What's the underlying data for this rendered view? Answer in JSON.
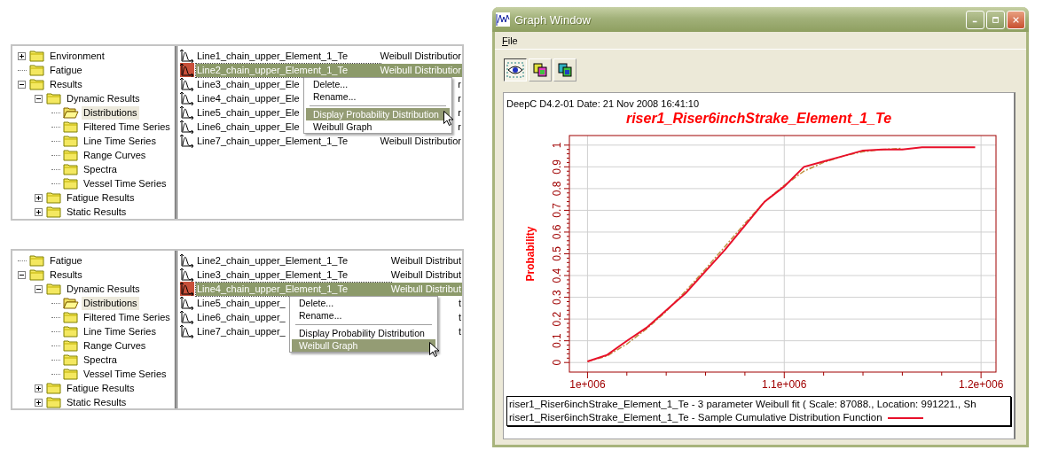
{
  "tree_panels": [
    {
      "tree": [
        {
          "label": "Environment",
          "expanded": false,
          "selected": false
        },
        {
          "label": "Fatigue",
          "selected": false
        },
        {
          "label": "Results",
          "expanded": true,
          "selected": false,
          "children": [
            {
              "label": "Dynamic Results",
              "expanded": true,
              "selected": false,
              "children": [
                {
                  "label": "Distributions",
                  "selected": true
                },
                {
                  "label": "Filtered Time Series",
                  "selected": false
                },
                {
                  "label": "Line Time Series",
                  "selected": false
                },
                {
                  "label": "Range Curves",
                  "selected": false
                },
                {
                  "label": "Spectra",
                  "selected": false
                },
                {
                  "label": "Vessel Time Series",
                  "selected": false
                }
              ]
            },
            {
              "label": "Fatigue Results",
              "expanded": false,
              "selected": false
            },
            {
              "label": "Static Results",
              "expanded": false,
              "selected": false
            }
          ]
        }
      ],
      "list": [
        {
          "name": "Line1_chain_upper_Element_1_Te",
          "type": "Weibull Distributior",
          "selected": false
        },
        {
          "name": "Line2_chain_upper_Element_1_Te",
          "type": "Weibull Distributior",
          "selected": true
        },
        {
          "name": "Line3_chain_upper_Ele",
          "type": "r",
          "selected": false
        },
        {
          "name": "Line4_chain_upper_Ele",
          "type": "r",
          "selected": false
        },
        {
          "name": "Line5_chain_upper_Ele",
          "type": "r",
          "selected": false
        },
        {
          "name": "Line6_chain_upper_Ele",
          "type": "r",
          "selected": false
        },
        {
          "name": "Line7_chain_upper_Element_1_Te",
          "type": "Weibull Distributior",
          "selected": false
        }
      ],
      "context_menu": [
        {
          "kind": "item",
          "label": "Delete...",
          "highlighted": false
        },
        {
          "kind": "item",
          "label": "Rename...",
          "highlighted": false
        },
        {
          "kind": "separator"
        },
        {
          "kind": "item",
          "label": "Display Probability Distribution",
          "highlighted": true
        },
        {
          "kind": "item",
          "label": "Weibull Graph",
          "highlighted": false
        }
      ]
    },
    {
      "tree": [
        {
          "label": "Fatigue",
          "selected": false
        },
        {
          "label": "Results",
          "expanded": true,
          "selected": false,
          "children": [
            {
              "label": "Dynamic Results",
              "expanded": true,
              "selected": false,
              "children": [
                {
                  "label": "Distributions",
                  "selected": true
                },
                {
                  "label": "Filtered Time Series",
                  "selected": false
                },
                {
                  "label": "Line Time Series",
                  "selected": false
                },
                {
                  "label": "Range Curves",
                  "selected": false
                },
                {
                  "label": "Spectra",
                  "selected": false
                },
                {
                  "label": "Vessel Time Series",
                  "selected": false
                }
              ]
            },
            {
              "label": "Fatigue Results",
              "expanded": false,
              "selected": false
            },
            {
              "label": "Static Results",
              "expanded": false,
              "selected": false
            }
          ]
        }
      ],
      "list": [
        {
          "name": "Line2_chain_upper_Element_1_Te",
          "type": "Weibull Distribut",
          "selected": false
        },
        {
          "name": "Line3_chain_upper_Element_1_Te",
          "type": "Weibull Distribut",
          "selected": false
        },
        {
          "name": "Line4_chain_upper_Element_1_Te",
          "type": "Weibull Distribut",
          "selected": true
        },
        {
          "name": "Line5_chain_upper_",
          "type": "t",
          "selected": false
        },
        {
          "name": "Line6_chain_upper_",
          "type": "t",
          "selected": false
        },
        {
          "name": "Line7_chain_upper_",
          "type": "t",
          "selected": false
        }
      ],
      "context_menu": [
        {
          "kind": "item",
          "label": "Delete...",
          "highlighted": false
        },
        {
          "kind": "item",
          "label": "Rename...",
          "highlighted": false
        },
        {
          "kind": "separator"
        },
        {
          "kind": "item",
          "label": "Display Probability Distribution",
          "highlighted": false
        },
        {
          "kind": "item",
          "label": "Weibull Graph",
          "highlighted": true
        }
      ]
    }
  ],
  "graph_window": {
    "title": "Graph Window",
    "menu": [
      "File"
    ],
    "toolbar": [
      {
        "kind": "view",
        "pressed": true
      },
      {
        "kind": "copy",
        "pressed": false
      },
      {
        "kind": "copy_alt",
        "pressed": false
      }
    ],
    "header": "DeepC D4.2-01 Date: 21 Nov 2008 16:41:10",
    "chart_data": {
      "type": "line",
      "title": "riser1_Riser6inchStrake_Element_1_Te",
      "ylabel": "Probability",
      "x": [
        1000000,
        1010000,
        1020000,
        1030000,
        1040000,
        1050000,
        1060000,
        1070000,
        1080000,
        1090000,
        1100000,
        1110000,
        1120000,
        1130000,
        1140000,
        1150000,
        1160000,
        1170000,
        1180000,
        1190000,
        1197000
      ],
      "series": [
        {
          "name": "riser1_Riser6inchStrake_Element_1_Te - 3 parameter Weibull fit ( Scale: 87088., Location: 991221., Sh",
          "color": "#c09040",
          "line_style": "dashdot",
          "values": [
            0.005,
            0.03,
            0.085,
            0.155,
            0.235,
            0.33,
            0.43,
            0.535,
            0.64,
            0.74,
            0.815,
            0.88,
            0.92,
            0.95,
            0.97,
            0.98,
            0.985,
            null,
            null,
            null,
            null
          ]
        },
        {
          "name": "riser1_Riser6inchStrake_Element_1_Te - Sample Cumulative Distribution Function",
          "color": "#e8102a",
          "line_style": "solid",
          "values": [
            0.005,
            0.035,
            0.1,
            0.16,
            0.24,
            0.32,
            0.42,
            0.52,
            0.63,
            0.74,
            0.81,
            0.9,
            0.925,
            0.95,
            0.975,
            0.98,
            0.98,
            0.99,
            0.99,
            0.99,
            0.99
          ]
        }
      ],
      "grid": true,
      "xlim": [
        990800,
        1207600
      ],
      "ylim": [
        -0.044,
        1.044
      ],
      "xticks": [
        {
          "value": 1000000,
          "label": "1e+006"
        },
        {
          "value": 1100000,
          "label": "1.1e+006"
        },
        {
          "value": 1200000,
          "label": "1.2e+006"
        }
      ],
      "yticks": [
        0,
        0.1,
        0.2,
        0.3,
        0.4,
        0.5,
        0.6,
        0.7,
        0.8,
        0.9,
        1
      ]
    }
  }
}
